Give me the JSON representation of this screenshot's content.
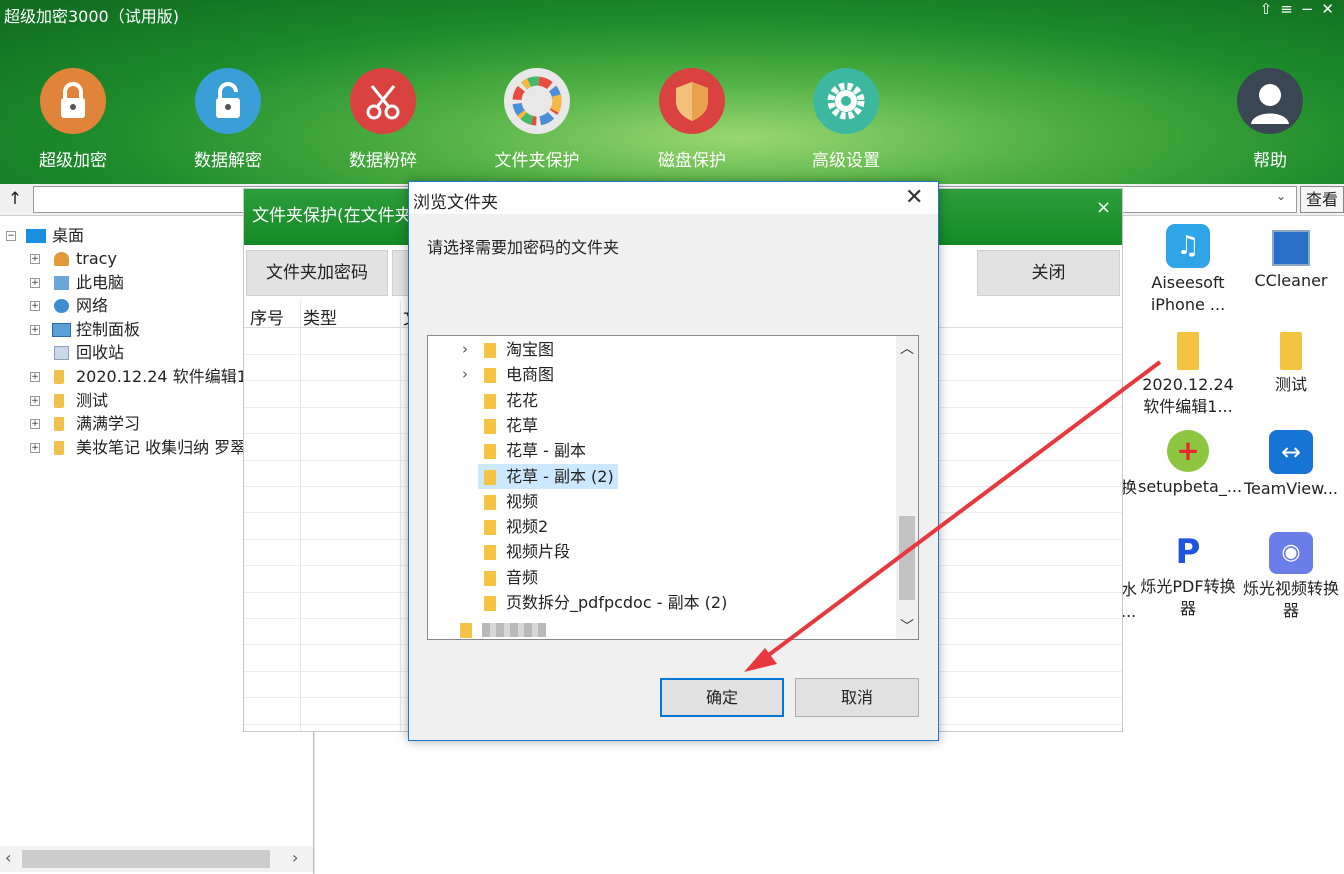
{
  "app": {
    "title": "超级加密3000（试用版)",
    "win_controls": [
      "⇧",
      "≡",
      "−",
      "✕"
    ]
  },
  "toolbar": [
    {
      "label": "超级加密",
      "icon": "lock-icon",
      "color": "#e0843a"
    },
    {
      "label": "数据解密",
      "icon": "unlock-icon",
      "color": "#3a9fd6"
    },
    {
      "label": "数据粉碎",
      "icon": "scissors-icon",
      "color": "#d9423f"
    },
    {
      "label": "文件夹保护",
      "icon": "folder-protect-icon",
      "color": "#e8e8e8"
    },
    {
      "label": "磁盘保护",
      "icon": "shield-icon",
      "color": "#d9423f"
    },
    {
      "label": "高级设置",
      "icon": "gear-icon",
      "color": "#3db8a0"
    },
    {
      "label": "帮助",
      "icon": "user-help-icon",
      "color": "#3b4654"
    }
  ],
  "address_bar": {
    "up": "↑",
    "value": "",
    "dropdown": "⌄",
    "view_button": "查看"
  },
  "tree": [
    {
      "label": "桌面",
      "icon": "desktop-icon"
    },
    {
      "label": "tracy",
      "icon": "user-icon"
    },
    {
      "label": "此电脑",
      "icon": "computer-icon"
    },
    {
      "label": "网络",
      "icon": "network-icon"
    },
    {
      "label": "控制面板",
      "icon": "control-panel-icon"
    },
    {
      "label": "回收站",
      "icon": "recycle-bin-icon"
    },
    {
      "label": "2020.12.24 软件编辑1",
      "icon": "folder-icon"
    },
    {
      "label": "测试",
      "icon": "folder-icon"
    },
    {
      "label": "满满学习",
      "icon": "folder-icon"
    },
    {
      "label": "美妆笔记 收集归纳 罗翠",
      "icon": "folder-icon"
    }
  ],
  "desktop": {
    "edge_texts": [
      ".",
      "换",
      "水",
      "..."
    ],
    "items": [
      {
        "label1": "Aiseesoft",
        "label2": "iPhone ...",
        "icon": "aiseesoft-icon"
      },
      {
        "label1": "CCleaner",
        "label2": "",
        "icon": "ccleaner-icon"
      },
      {
        "label1": "2020.12.24",
        "label2": "软件编辑1...",
        "icon": "folder-icon"
      },
      {
        "label1": "测试",
        "label2": "",
        "icon": "folder-icon"
      },
      {
        "label1": "setupbeta_...",
        "label2": "",
        "icon": "setup-icon"
      },
      {
        "label1": "TeamView...",
        "label2": "",
        "icon": "teamviewer-icon"
      },
      {
        "label1": "烁光PDF转换",
        "label2": "器",
        "icon": "pdf-converter-icon"
      },
      {
        "label1": "烁光视频转换",
        "label2": "器",
        "icon": "video-converter-icon"
      }
    ]
  },
  "folder_protect": {
    "title": "文件夹保护(在文件夹",
    "close": "×",
    "encrypt_button": "文件夹加密码",
    "close_button": "关闭",
    "columns": [
      "序号",
      "类型",
      "文"
    ]
  },
  "dialog": {
    "title": "浏览文件夹",
    "close": "✕",
    "prompt": "请选择需要加密码的文件夹",
    "folders": [
      {
        "label": "淘宝图",
        "expandable": true
      },
      {
        "label": "电商图",
        "expandable": true
      },
      {
        "label": "花花",
        "expandable": false
      },
      {
        "label": "花草",
        "expandable": false
      },
      {
        "label": "花草 - 副本",
        "expandable": false
      },
      {
        "label": "花草 - 副本 (2)",
        "expandable": false,
        "selected": true
      },
      {
        "label": "视频",
        "expandable": false
      },
      {
        "label": "视频2",
        "expandable": false
      },
      {
        "label": "视频片段",
        "expandable": false
      },
      {
        "label": "音频",
        "expandable": false
      },
      {
        "label": "页数拆分_pdfpcdoc - 副本 (2)",
        "expandable": false
      }
    ],
    "chevron": "›",
    "scroll_up": "︿",
    "scroll_down": "﹀",
    "ok": "确定",
    "cancel": "取消"
  },
  "colors": {
    "header_green": "#1e8c2c",
    "dialog_border": "#1979ca",
    "selection": "#cce8ff",
    "annotation_arrow": "#e8383d"
  }
}
